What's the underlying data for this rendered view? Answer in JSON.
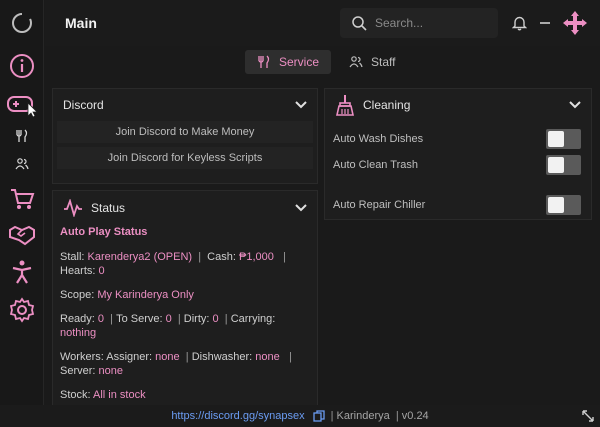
{
  "header": {
    "title": "Main",
    "search_placeholder": "Search...",
    "icons": [
      "bell-icon",
      "minimize-icon",
      "move-icon"
    ]
  },
  "sidebar": {
    "items": [
      {
        "icon": "logo-ring-icon"
      },
      {
        "icon": "info-icon"
      },
      {
        "icon": "gamepad-icon"
      },
      {
        "icon": "utensils-icon"
      },
      {
        "icon": "users-icon"
      },
      {
        "icon": "cart-icon"
      },
      {
        "icon": "handshake-icon"
      },
      {
        "icon": "person-icon"
      },
      {
        "icon": "gear-icon"
      }
    ]
  },
  "tabs": [
    {
      "label": "Service",
      "icon": "utensils-icon",
      "active": true
    },
    {
      "label": "Staff",
      "icon": "users-icon",
      "active": false
    }
  ],
  "discord": {
    "title": "Discord",
    "buttons": [
      "Join Discord to Make Money",
      "Join Discord for Keyless Scripts"
    ]
  },
  "status": {
    "title": "Status",
    "heading": "Auto Play Status",
    "stall_label": "Stall:",
    "stall_value": "Karenderya2 (OPEN)",
    "cash_label": "Cash:",
    "cash_value": "₱1,000",
    "hearts_label": "Hearts:",
    "hearts_value": "0",
    "scope_label": "Scope:",
    "scope_value": "My Karinderya Only",
    "ready_label": "Ready:",
    "ready_value": "0",
    "toserve_label": "To Serve:",
    "toserve_value": "0",
    "dirty_label": "Dirty:",
    "dirty_value": "0",
    "carrying_label": "Carrying:",
    "carrying_value": "nothing",
    "workers_label": "Workers: Assigner:",
    "workers_value": "none",
    "dishwasher_label": "Dishwasher:",
    "dishwasher_value": "none",
    "server_label": "Server:",
    "server_value": "none",
    "stock_label": "Stock:",
    "stock_value": "All in stock"
  },
  "cleaning": {
    "title": "Cleaning",
    "toggles": [
      {
        "label": "Auto Wash Dishes",
        "on": false
      },
      {
        "label": "Auto Clean Trash",
        "on": false
      },
      {
        "label": "Auto Repair Chiller",
        "on": false
      }
    ]
  },
  "footer": {
    "link": "https://discord.gg/synapsex",
    "game": "Karinderya",
    "version": "v0.24"
  },
  "colors": {
    "accent": "#ec8fc3",
    "link": "#6b9cf2",
    "background": "#1a1a1a"
  }
}
